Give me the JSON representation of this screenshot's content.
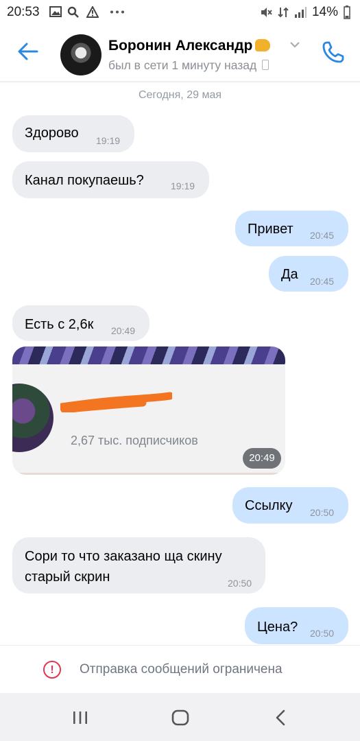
{
  "status_bar": {
    "time": "20:53",
    "battery": "14%"
  },
  "header": {
    "contact_name": "Боронин Александр",
    "last_seen": "был в сети 1 минуту назад"
  },
  "chat": {
    "date_separator": "Сегодня, 29 мая",
    "messages": [
      {
        "text": "Здорово",
        "time": "19:19",
        "direction": "incoming"
      },
      {
        "text": "Канал покупаешь?",
        "time": "19:19",
        "direction": "incoming"
      },
      {
        "text": "Привет",
        "time": "20:45",
        "direction": "outgoing"
      },
      {
        "text": "Да",
        "time": "20:45",
        "direction": "outgoing"
      },
      {
        "text": "Есть с 2,6к",
        "time": "20:49",
        "direction": "incoming"
      },
      {
        "text": "Ссылку",
        "time": "20:50",
        "direction": "outgoing"
      },
      {
        "text_line1": "Сори то что заказано ща скину",
        "text_line2": "старый скрин",
        "time": "20:50",
        "direction": "incoming"
      },
      {
        "text": "Цена?",
        "time": "20:50",
        "direction": "outgoing"
      }
    ],
    "shared_card": {
      "subscribers": "2,67 тыс. подписчиков",
      "time": "20:49"
    }
  },
  "restriction": {
    "text": "Отправка сообщений ограничена",
    "icon": "exclamation-icon",
    "color": "#e0364f"
  },
  "colors": {
    "accent": "#2a88e0",
    "incoming_bubble": "#ebedf0",
    "outgoing_bubble": "#cce4ff"
  }
}
